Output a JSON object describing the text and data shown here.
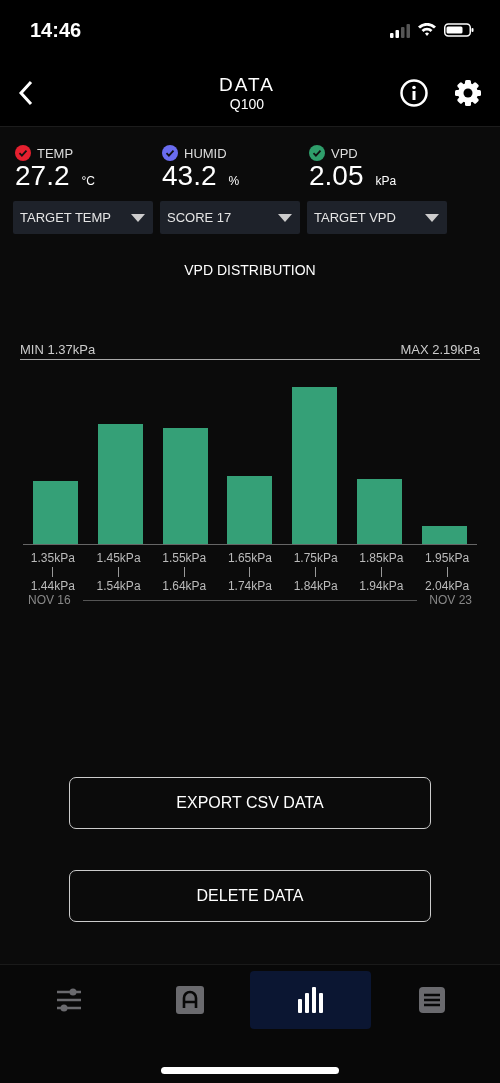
{
  "status_bar": {
    "time": "14:46"
  },
  "header": {
    "title": "DATA",
    "subtitle": "Q100"
  },
  "metrics": [
    {
      "label": "TEMP",
      "value": "27.2",
      "unit": "°C",
      "checked": true,
      "color": "#e5202f"
    },
    {
      "label": "HUMID",
      "value": "43.2",
      "unit": "%",
      "checked": true,
      "color": "#6a6cf0"
    },
    {
      "label": "VPD",
      "value": "2.05",
      "unit": "kPa",
      "checked": true,
      "color": "#2f9e6b"
    }
  ],
  "dropdowns": [
    "TARGET TEMP",
    "SCORE 17",
    "TARGET VPD"
  ],
  "distribution": {
    "title": "VPD DISTRIBUTION",
    "min": "MIN 1.37kPa",
    "max": "MAX 2.19kPa",
    "bins": [
      {
        "from": "1.35kPa",
        "to": "1.44kPa"
      },
      {
        "from": "1.45kPa",
        "to": "1.54kPa"
      },
      {
        "from": "1.55kPa",
        "to": "1.64kPa"
      },
      {
        "from": "1.65kPa",
        "to": "1.74kPa"
      },
      {
        "from": "1.75kPa",
        "to": "1.84kPa"
      },
      {
        "from": "1.85kPa",
        "to": "1.94kPa"
      },
      {
        "from": "1.95kPa",
        "to": "2.04kPa"
      }
    ],
    "start_date": "NOV 16",
    "end_date": "NOV 23"
  },
  "buttons": [
    "EXPORT CSV DATA",
    "DELETE DATA"
  ],
  "tab_bar": [
    {
      "kind": "sliders",
      "selected": false
    },
    {
      "kind": "auto",
      "selected": false
    },
    {
      "kind": "chart",
      "selected": true
    },
    {
      "kind": "list",
      "selected": false
    }
  ]
}
